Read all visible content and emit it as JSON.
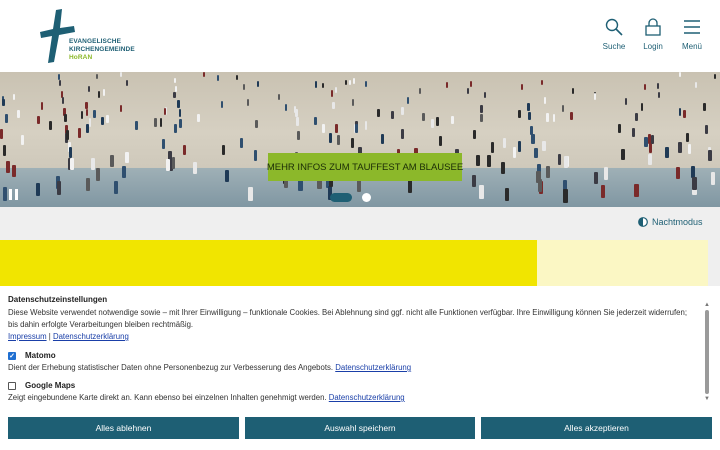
{
  "header": {
    "logo": {
      "line1": "EVANGELISCHE",
      "line2": "KIRCHENGEMEINDE",
      "line3": "HoRAN"
    },
    "nav": [
      {
        "icon": "search-icon",
        "label": "Suche"
      },
      {
        "icon": "lock-icon",
        "label": "Login"
      },
      {
        "icon": "hamburger-icon",
        "label": "Menü"
      }
    ]
  },
  "hero": {
    "cta": "MEHR INFOS ZUM TAUFFEST AM BLAUSEE",
    "slides_total": 2,
    "slide_active": 1
  },
  "nightmode": {
    "label": "Nachtmodus",
    "icon": "half-circle-icon"
  },
  "cookie": {
    "title": "Datenschutzeinstellungen",
    "intro": "Diese Website verwendet notwendige sowie – mit Ihrer Einwilligung – funktionale Cookies. Bei Ablehnung sind ggf. nicht alle Funktionen verfügbar. Ihre Einwilligung können Sie jederzeit widerrufen; bis dahin erfolgte Verarbeitungen bleiben rechtmäßig.",
    "impressum": "Impressum",
    "separator": "|",
    "privacy": "Datenschutzerklärung",
    "options": [
      {
        "name": "Matomo",
        "checked": true,
        "desc": "Dient der Erhebung statistischer Daten ohne Personenbezug zur Verbesserung des Angebots.",
        "link": "Datenschutzerklärung"
      },
      {
        "name": "Google Maps",
        "checked": false,
        "desc": "Zeigt eingebundene Karte direkt an. Kann ebenso bei einzelnen Inhalten genehmigt werden.",
        "link": "Datenschutzerklärung"
      }
    ],
    "buttons": {
      "reject": "Alles ablehnen",
      "save": "Auswahl speichern",
      "accept": "Alles akzeptieren"
    }
  },
  "colors": {
    "brand": "#1e5f74",
    "accent_green": "#8cb82a",
    "yellow": "#f1e500",
    "pale_yellow": "#fbf7c4"
  }
}
